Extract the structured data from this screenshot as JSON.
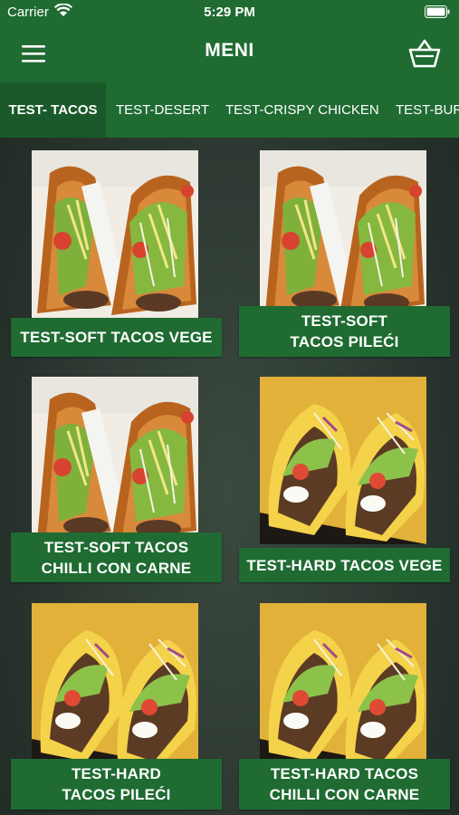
{
  "status": {
    "carrier": "Carrier",
    "time": "5:29 PM"
  },
  "header": {
    "title": "MENI"
  },
  "tabs": [
    {
      "label": "TEST- TACOS",
      "active": true
    },
    {
      "label": "TEST-DESERT",
      "active": false
    },
    {
      "label": "TEST-CRISPY CHICKEN",
      "active": false
    },
    {
      "label": "TEST-BUR",
      "active": false
    }
  ],
  "items": [
    {
      "line1": "TEST-SOFT TACOS VEGE",
      "line2": "",
      "image": "soft-taco-image"
    },
    {
      "line1": "TEST-SOFT",
      "line2": "TACOS PILEĆI",
      "image": "soft-taco-image"
    },
    {
      "line1": "TEST-SOFT TACOS",
      "line2": "CHILLI CON CARNE",
      "image": "soft-taco-image"
    },
    {
      "line1": "TEST-HARD TACOS VEGE",
      "line2": "",
      "image": "hard-taco-image"
    },
    {
      "line1": "TEST-HARD",
      "line2": "TACOS PILEĆI",
      "image": "hard-taco-image"
    },
    {
      "line1": "TEST-HARD TACOS",
      "line2": "CHILLI CON CARNE",
      "image": "hard-taco-image"
    }
  ],
  "colors": {
    "primary": "#1f6b32",
    "active_tab": "#1a5a2a",
    "background": "#2b3630"
  }
}
